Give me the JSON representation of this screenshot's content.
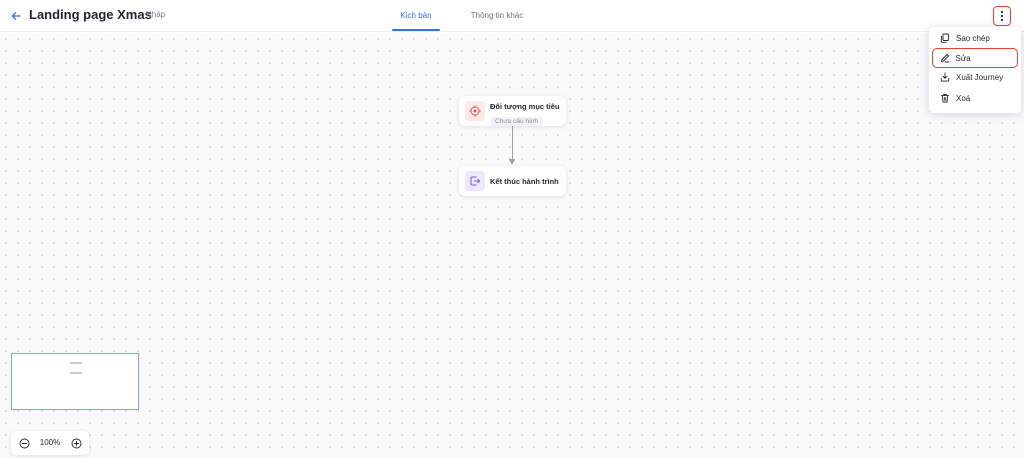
{
  "header": {
    "title": "Landing page Xmas",
    "status": "Nháp",
    "tabs": [
      {
        "label": "Kịch bản",
        "active": true
      },
      {
        "label": "Thông tin khác",
        "active": false
      }
    ],
    "back_icon": "arrow-left-icon",
    "more_icon": "more-vertical-icon"
  },
  "canvas": {
    "nodes": [
      {
        "title": "Đối tượng mục tiêu",
        "subtitle": "Chưa cấu hình",
        "icon": "target-icon"
      },
      {
        "title": "Kết thúc hành trình",
        "icon": "exit-icon"
      }
    ]
  },
  "menu": {
    "items": [
      {
        "label": "Sao chép",
        "icon": "copy-icon"
      },
      {
        "label": "Sửa",
        "icon": "edit-icon",
        "highlighted": true
      },
      {
        "label": "Xuất Journey",
        "icon": "download-icon"
      },
      {
        "label": "Xoá",
        "icon": "trash-icon"
      }
    ]
  },
  "zoom": {
    "level": "100%"
  },
  "colors": {
    "accent": "#3b6fe0",
    "highlight": "#e0462f",
    "target_icon": "#e5544b",
    "end_icon": "#7b5ae0"
  }
}
